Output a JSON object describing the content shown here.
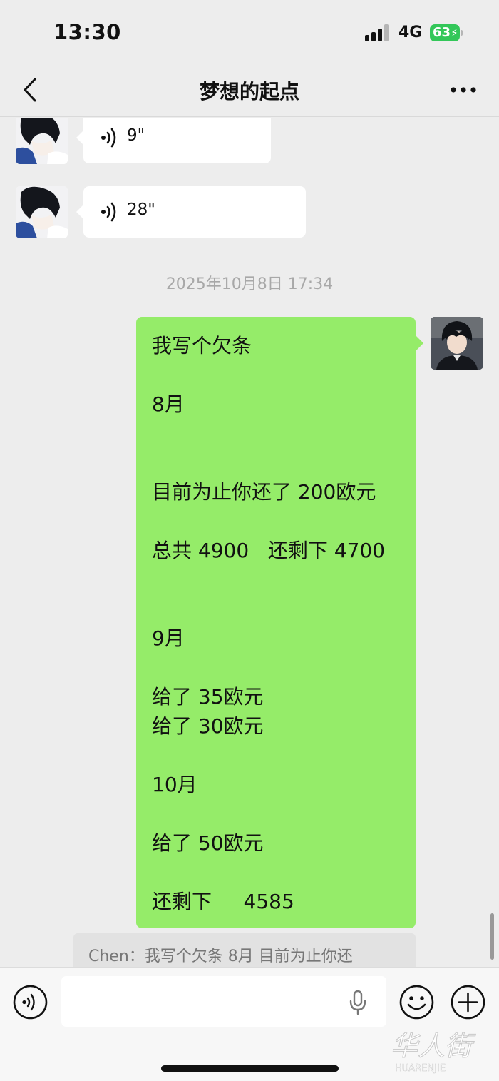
{
  "status_bar": {
    "time": "13:30",
    "network": "4G",
    "battery": "63",
    "signal_bars": 3,
    "signal_bars_total": 4
  },
  "nav": {
    "title": "梦想的起点",
    "back_icon": "chevron-left-icon",
    "more_icon": "more-dots-icon"
  },
  "chat": {
    "voice_messages": [
      {
        "duration": "9\""
      },
      {
        "duration": "28\""
      }
    ],
    "timestamp": "2025年10月8日 17:34",
    "sent_message": {
      "text": "我写个欠条\n\n8月\n\n\n目前为止你还了 200欧元\n\n总共 4900   还剩下 4700\n\n\n9月\n\n给了 35欧元\n给了 30欧元\n\n10月\n\n给了 50欧元\n\n还剩下     4585"
    },
    "quote": "Chen：我写个欠条   8月    目前为止你还"
  },
  "input_bar": {
    "voice_icon": "voice-mode-icon",
    "mic_icon": "microphone-icon",
    "emoji_icon": "emoji-icon",
    "plus_icon": "plus-icon"
  },
  "watermark": {
    "text": "华人街",
    "subtext": "HUARENJIE"
  },
  "colors": {
    "background": "#ededed",
    "sent_bubble": "#95ec69",
    "received_bubble": "#ffffff",
    "battery": "#33c759"
  }
}
